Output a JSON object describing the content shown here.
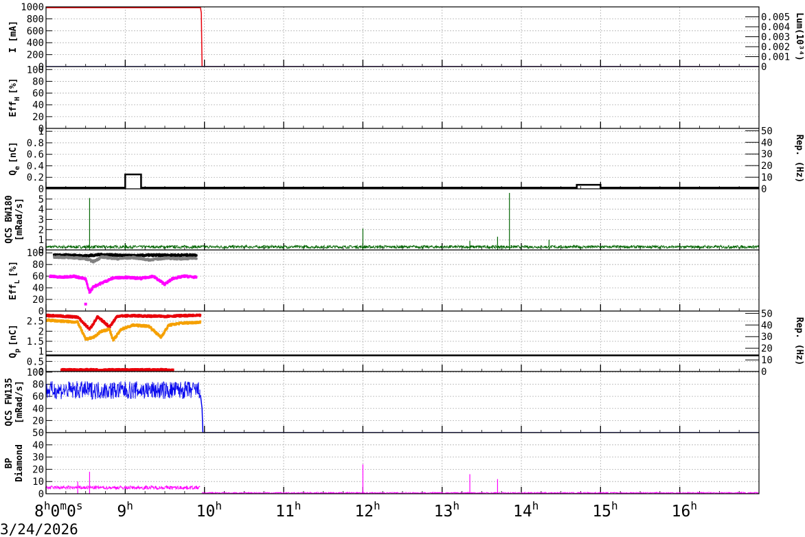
{
  "date_label": "3/24/2026",
  "colors": {
    "red": "#e8000b",
    "blue": "#0000ee",
    "black": "#000000",
    "gray": "#808080",
    "magenta": "#ff00ff",
    "green": "#006400",
    "orange": "#f5a000"
  },
  "chart_data": {
    "type": "line",
    "x_axis": {
      "unit": "hours",
      "range": [
        8.0,
        17.0
      ],
      "ticks": [
        8,
        9,
        10,
        11,
        12,
        13,
        14,
        15,
        16
      ],
      "tick_labels": [
        {
          "h": "8",
          "sup": "h",
          "m": "0",
          "msup": "m",
          "s": "0",
          "ssup": "s"
        },
        {
          "h": "9",
          "sup": "h"
        },
        {
          "h": "10",
          "sup": "h"
        },
        {
          "h": "11",
          "sup": "h"
        },
        {
          "h": "12",
          "sup": "h"
        },
        {
          "h": "13",
          "sup": "h"
        },
        {
          "h": "14",
          "sup": "h"
        },
        {
          "h": "15",
          "sup": "h"
        },
        {
          "h": "16",
          "sup": "h"
        }
      ]
    },
    "grid": true,
    "panels": [
      {
        "id": "current",
        "ylabel": [
          "I [mA]"
        ],
        "ylim": [
          0,
          1000
        ],
        "yticks": [
          "0",
          "200",
          "400",
          "600",
          "800",
          "1000"
        ],
        "right_axis": {
          "label": "Lum(10³⁴)",
          "ylim": [
            0,
            0.006
          ],
          "ticks": [
            "0",
            "0.001",
            "0.002",
            "0.003",
            "0.004",
            "0.005"
          ]
        },
        "series": [
          {
            "color": "red",
            "style": "line",
            "points": [
              [
                8.0,
                985
              ],
              [
                9.95,
                985
              ],
              [
                9.96,
                900
              ],
              [
                9.97,
                0
              ],
              [
                17.0,
                0
              ]
            ]
          },
          {
            "color": "blue",
            "style": "line",
            "points": [
              [
                8.0,
                0
              ],
              [
                17.0,
                0
              ]
            ]
          }
        ]
      },
      {
        "id": "eff_h",
        "ylabel": [
          "Eff",
          "H",
          "[%]"
        ],
        "ylim": [
          0,
          105
        ],
        "yticks": [
          "0",
          "20",
          "40",
          "60",
          "80",
          "100"
        ],
        "series": []
      },
      {
        "id": "qe",
        "ylabel": [
          "Q",
          "e",
          "[nC]"
        ],
        "ylim": [
          0,
          1.05
        ],
        "yticks": [
          "0",
          "0.2",
          "0.4",
          "0.6",
          "0.8",
          "1"
        ],
        "right_axis": {
          "label": "Rep. (Hz)",
          "ylim": [
            0,
            52
          ],
          "ticks": [
            "0",
            "10",
            "20",
            "30",
            "40",
            "50"
          ]
        },
        "series": [
          {
            "color": "black",
            "style": "line",
            "points": [
              [
                8.0,
                0.02
              ],
              [
                9.0,
                0.02
              ],
              [
                9.0,
                0.25
              ],
              [
                9.2,
                0.25
              ],
              [
                9.2,
                0.02
              ],
              [
                14.7,
                0.02
              ],
              [
                14.7,
                0.07
              ],
              [
                15.0,
                0.07
              ],
              [
                15.0,
                0.02
              ],
              [
                17.0,
                0.02
              ]
            ]
          }
        ]
      },
      {
        "id": "qcs_bw180",
        "ylabel": [
          "QCS BW180",
          "[mRad/s]"
        ],
        "ylim": [
          0,
          6
        ],
        "yticks": [
          "0",
          "1",
          "2",
          "3",
          "4",
          "5"
        ],
        "series": [
          {
            "color": "green",
            "style": "noise",
            "base": 0.3,
            "amp": 0.15,
            "range": [
              8.0,
              17.0
            ]
          },
          {
            "color": "green",
            "style": "spikes",
            "points": [
              [
                8.55,
                5.1
              ],
              [
                9.0,
                0.6
              ],
              [
                12.0,
                2.1
              ],
              [
                13.35,
                0.9
              ],
              [
                13.7,
                1.3
              ],
              [
                13.85,
                5.6
              ],
              [
                14.35,
                1.0
              ]
            ]
          }
        ]
      },
      {
        "id": "eff_l",
        "ylabel": [
          "Eff",
          "L",
          "[%]"
        ],
        "ylim": [
          0,
          105
        ],
        "yticks": [
          "0",
          "20",
          "40",
          "60",
          "80",
          "100"
        ],
        "series": [
          {
            "color": "black",
            "style": "scatter",
            "points": [
              [
                8.1,
                96
              ],
              [
                8.3,
                96
              ],
              [
                8.5,
                95
              ],
              [
                8.7,
                97
              ],
              [
                8.9,
                96
              ],
              [
                9.1,
                95
              ],
              [
                9.3,
                96
              ],
              [
                9.5,
                96
              ],
              [
                9.7,
                96
              ],
              [
                9.9,
                96
              ]
            ]
          },
          {
            "color": "gray",
            "style": "scatter",
            "points": [
              [
                8.1,
                93
              ],
              [
                8.3,
                92
              ],
              [
                8.5,
                90
              ],
              [
                8.6,
                85
              ],
              [
                8.7,
                93
              ],
              [
                8.9,
                90
              ],
              [
                9.1,
                92
              ],
              [
                9.3,
                88
              ],
              [
                9.5,
                91
              ],
              [
                9.7,
                90
              ],
              [
                9.9,
                91
              ]
            ]
          },
          {
            "color": "magenta",
            "style": "scatter",
            "points": [
              [
                8.05,
                60
              ],
              [
                8.2,
                58
              ],
              [
                8.35,
                60
              ],
              [
                8.5,
                55
              ],
              [
                8.55,
                32
              ],
              [
                8.6,
                42
              ],
              [
                8.7,
                48
              ],
              [
                8.85,
                57
              ],
              [
                9.0,
                58
              ],
              [
                9.2,
                56
              ],
              [
                9.35,
                60
              ],
              [
                9.5,
                46
              ],
              [
                9.6,
                56
              ],
              [
                9.75,
                60
              ],
              [
                9.9,
                58
              ],
              [
                8.5,
                12
              ]
            ]
          }
        ]
      },
      {
        "id": "qp",
        "ylabel": [
          "Q",
          "p",
          "[nC]"
        ],
        "ylim": [
          0,
          3.0
        ],
        "yticks": [
          "0",
          "0.5",
          "1",
          "1.5",
          "2",
          "2.5"
        ],
        "right_axis": {
          "label": "Rep. (Hz)",
          "ylim": [
            0,
            52
          ],
          "ticks": [
            "0",
            "10",
            "20",
            "30",
            "40",
            "50"
          ]
        },
        "series": [
          {
            "color": "red",
            "style": "scatter",
            "points": [
              [
                8.0,
                2.78
              ],
              [
                8.2,
                2.75
              ],
              [
                8.4,
                2.7
              ],
              [
                8.5,
                2.3
              ],
              [
                8.55,
                2.1
              ],
              [
                8.65,
                2.7
              ],
              [
                8.75,
                2.4
              ],
              [
                8.8,
                2.2
              ],
              [
                8.9,
                2.75
              ],
              [
                9.1,
                2.77
              ],
              [
                9.3,
                2.75
              ],
              [
                9.5,
                2.74
              ],
              [
                9.7,
                2.77
              ],
              [
                9.95,
                2.78
              ],
              [
                8.2,
                0.08
              ],
              [
                8.6,
                0.08
              ],
              [
                9.6,
                0.08
              ]
            ]
          },
          {
            "color": "orange",
            "style": "scatter",
            "points": [
              [
                8.0,
                2.55
              ],
              [
                8.2,
                2.5
              ],
              [
                8.4,
                2.45
              ],
              [
                8.5,
                1.6
              ],
              [
                8.6,
                1.7
              ],
              [
                8.7,
                2.0
              ],
              [
                8.8,
                2.1
              ],
              [
                8.85,
                1.55
              ],
              [
                8.95,
                2.1
              ],
              [
                9.1,
                2.3
              ],
              [
                9.3,
                2.25
              ],
              [
                9.45,
                1.7
              ],
              [
                9.55,
                2.3
              ],
              [
                9.7,
                2.4
              ],
              [
                9.95,
                2.45
              ]
            ]
          },
          {
            "color": "black",
            "style": "line",
            "points": [
              [
                8.0,
                0.8
              ],
              [
                17.0,
                0.8
              ]
            ]
          }
        ]
      },
      {
        "id": "qcs_fw135",
        "ylabel": [
          "QCS FW135",
          "[mRad/s]"
        ],
        "ylim": [
          50,
          101
        ],
        "yticks": [
          "50",
          "60",
          "80",
          "100"
        ],
        "ytick_values": [
          0,
          20,
          40,
          60,
          80,
          100
        ],
        "ytick_display": [
          "50",
          "20",
          "40",
          "60",
          "80",
          "100"
        ],
        "series": [
          {
            "color": "blue",
            "style": "noise",
            "base": 70,
            "amp": 15,
            "range": [
              8.0,
              9.95
            ]
          },
          {
            "color": "blue",
            "style": "line",
            "points": [
              [
                9.95,
                62
              ],
              [
                9.97,
                40
              ],
              [
                9.98,
                0
              ],
              [
                17.0,
                0
              ]
            ]
          }
        ]
      },
      {
        "id": "bp_diamond",
        "ylabel": [
          "BP",
          "Diamond"
        ],
        "ylim": [
          0,
          50
        ],
        "yticks": [
          "0",
          "10",
          "20",
          "30",
          "40"
        ],
        "series": [
          {
            "color": "magenta",
            "style": "noise",
            "base": 5,
            "amp": 1.5,
            "range": [
              8.0,
              9.95
            ]
          },
          {
            "color": "magenta",
            "style": "noise",
            "base": 0.6,
            "amp": 0.5,
            "range": [
              9.97,
              17.0
            ]
          },
          {
            "color": "magenta",
            "style": "spikes",
            "points": [
              [
                8.4,
                10
              ],
              [
                8.55,
                18
              ],
              [
                12.0,
                24
              ],
              [
                13.35,
                16
              ],
              [
                13.7,
                12
              ]
            ]
          }
        ]
      }
    ]
  }
}
